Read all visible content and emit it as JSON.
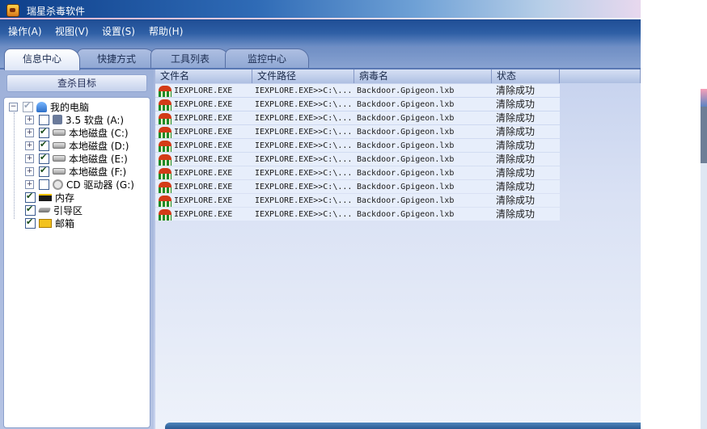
{
  "window": {
    "title": "瑞星杀毒软件"
  },
  "menu": [
    "操作(A)",
    "视图(V)",
    "设置(S)",
    "帮助(H)"
  ],
  "tabs": [
    "信息中心",
    "快捷方式",
    "工具列表",
    "监控中心"
  ],
  "left_panel": {
    "header": "查杀目标",
    "tree": {
      "root": {
        "label": "我的电脑",
        "checked": true,
        "icon": "computer-icon"
      },
      "drives": [
        {
          "label": "3.5 软盘 (A:)",
          "checked": false,
          "icon": "floppy-icon"
        },
        {
          "label": "本地磁盘 (C:)",
          "checked": true,
          "icon": "hard-disk-icon"
        },
        {
          "label": "本地磁盘 (D:)",
          "checked": true,
          "icon": "hard-disk-icon"
        },
        {
          "label": "本地磁盘 (E:)",
          "checked": true,
          "icon": "hard-disk-icon"
        },
        {
          "label": "本地磁盘 (F:)",
          "checked": true,
          "icon": "hard-disk-icon"
        },
        {
          "label": "CD 驱动器 (G:)",
          "checked": false,
          "icon": "cd-drive-icon"
        }
      ],
      "others": [
        {
          "label": "内存",
          "checked": true,
          "icon": "memory-icon"
        },
        {
          "label": "引导区",
          "checked": true,
          "icon": "boot-sector-icon"
        },
        {
          "label": "邮箱",
          "checked": true,
          "icon": "mailbox-icon"
        }
      ]
    }
  },
  "results_table": {
    "columns": [
      "文件名",
      "文件路径",
      "病毒名",
      "状态"
    ],
    "rows": [
      {
        "file": "IEXPLORE.EXE",
        "path": "IEXPLORE.EXE>>C:\\...",
        "virus": "Backdoor.Gpigeon.lxb",
        "status": "清除成功"
      },
      {
        "file": "IEXPLORE.EXE",
        "path": "IEXPLORE.EXE>>C:\\...",
        "virus": "Backdoor.Gpigeon.lxb",
        "status": "清除成功"
      },
      {
        "file": "IEXPLORE.EXE",
        "path": "IEXPLORE.EXE>>C:\\...",
        "virus": "Backdoor.Gpigeon.lxb",
        "status": "清除成功"
      },
      {
        "file": "IEXPLORE.EXE",
        "path": "IEXPLORE.EXE>>C:\\...",
        "virus": "Backdoor.Gpigeon.lxb",
        "status": "清除成功"
      },
      {
        "file": "IEXPLORE.EXE",
        "path": "IEXPLORE.EXE>>C:\\...",
        "virus": "Backdoor.Gpigeon.lxb",
        "status": "清除成功"
      },
      {
        "file": "IEXPLORE.EXE",
        "path": "IEXPLORE.EXE>>C:\\...",
        "virus": "Backdoor.Gpigeon.lxb",
        "status": "清除成功"
      },
      {
        "file": "IEXPLORE.EXE",
        "path": "IEXPLORE.EXE>>C:\\...",
        "virus": "Backdoor.Gpigeon.lxb",
        "status": "清除成功"
      },
      {
        "file": "IEXPLORE.EXE",
        "path": "IEXPLORE.EXE>>C:\\...",
        "virus": "Backdoor.Gpigeon.lxb",
        "status": "清除成功"
      },
      {
        "file": "IEXPLORE.EXE",
        "path": "IEXPLORE.EXE>>C:\\...",
        "virus": "Backdoor.Gpigeon.lxb",
        "status": "清除成功"
      },
      {
        "file": "IEXPLORE.EXE",
        "path": "IEXPLORE.EXE>>C:\\...",
        "virus": "Backdoor.Gpigeon.lxb",
        "status": "清除成功"
      }
    ]
  }
}
